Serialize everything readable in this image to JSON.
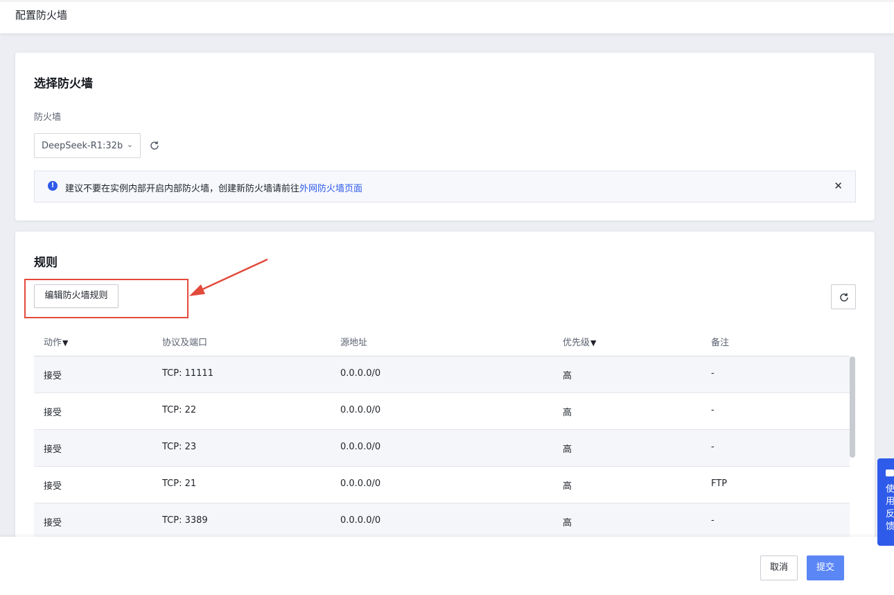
{
  "header": {
    "title": "配置防火墙"
  },
  "firewall_card": {
    "title": "选择防火墙",
    "field_label": "防火墙",
    "selected": "DeepSeek-R1:32b",
    "alert": {
      "message": "建议不要在实例内部开启内部防火墙，创建新防火墙请前往",
      "link": "外网防火墙页面"
    }
  },
  "rules_card": {
    "title": "规则",
    "edit_button": "编辑防火墙规则",
    "columns": [
      "动作",
      "协议及端口",
      "源地址",
      "优先级",
      "备注"
    ],
    "rows": [
      {
        "action": "接受",
        "protocol": "TCP: 11111",
        "source": "0.0.0.0/0",
        "priority": "高",
        "note": "-"
      },
      {
        "action": "接受",
        "protocol": "TCP: 22",
        "source": "0.0.0.0/0",
        "priority": "高",
        "note": "-"
      },
      {
        "action": "接受",
        "protocol": "TCP: 23",
        "source": "0.0.0.0/0",
        "priority": "高",
        "note": "-"
      },
      {
        "action": "接受",
        "protocol": "TCP: 21",
        "source": "0.0.0.0/0",
        "priority": "高",
        "note": "FTP"
      },
      {
        "action": "接受",
        "protocol": "TCP: 3389",
        "source": "0.0.0.0/0",
        "priority": "高",
        "note": "-"
      }
    ]
  },
  "footer": {
    "cancel": "取消",
    "submit": "提交"
  },
  "feedback": {
    "label": "使用反馈"
  },
  "icons": {
    "info": "info-icon",
    "close": "close-icon",
    "refresh": "refresh-icon",
    "filter": "filter-icon",
    "chevron": "chevron-down-icon"
  },
  "colors": {
    "primary": "#2f5bea",
    "submit": "#5b86f5",
    "highlight": "#e24a3b"
  }
}
